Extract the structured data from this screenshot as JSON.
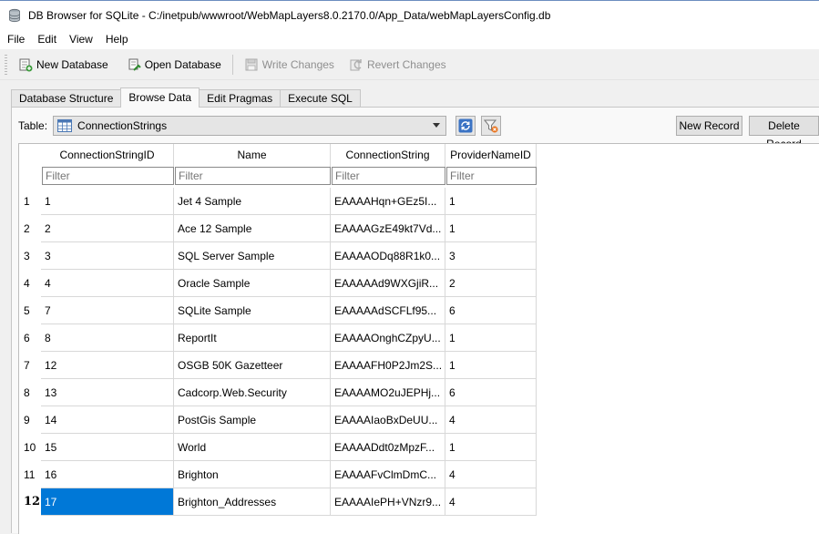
{
  "window": {
    "title": "DB Browser for SQLite - C:/inetpub/wwwroot/WebMapLayers8.0.2170.0/App_Data/webMapLayersConfig.db"
  },
  "menu": [
    "File",
    "Edit",
    "View",
    "Help"
  ],
  "toolbar": {
    "new_database": "New Database",
    "open_database": "Open Database",
    "write_changes": "Write Changes",
    "revert_changes": "Revert Changes"
  },
  "tabs": [
    "Database Structure",
    "Browse Data",
    "Edit Pragmas",
    "Execute SQL"
  ],
  "browse": {
    "table_label": "Table:",
    "table_value": "ConnectionStrings",
    "new_record": "New Record",
    "delete_record": "Delete Record"
  },
  "grid": {
    "columns": [
      "ConnectionStringID",
      "Name",
      "ConnectionString",
      "ProviderNameID"
    ],
    "filter_placeholder": "Filter",
    "rows": [
      [
        "1",
        "1",
        "Jet 4 Sample",
        "EAAAAHqn+GEz5I...",
        "1"
      ],
      [
        "2",
        "2",
        "Ace 12 Sample",
        "EAAAAGzE49kt7Vd...",
        "1"
      ],
      [
        "3",
        "3",
        "SQL Server Sample",
        "EAAAAODq88R1k0...",
        "3"
      ],
      [
        "4",
        "4",
        "Oracle Sample",
        "EAAAAAd9WXGjiR...",
        "2"
      ],
      [
        "5",
        "7",
        "SQLite Sample",
        "EAAAAAdSCFLf95...",
        "6"
      ],
      [
        "6",
        "8",
        "ReportIt",
        "EAAAAOnghCZpyU...",
        "1"
      ],
      [
        "7",
        "12",
        "OSGB 50K Gazetteer",
        "EAAAAFH0P2Jm2S...",
        "1"
      ],
      [
        "8",
        "13",
        "Cadcorp.Web.Security",
        "EAAAAMO2uJEPHj...",
        "6"
      ],
      [
        "9",
        "14",
        "PostGis Sample",
        "EAAAAIaoBxDeUU...",
        "4"
      ],
      [
        "10",
        "15",
        "World",
        "EAAAADdt0zMpzF...",
        "1"
      ],
      [
        "11",
        "16",
        "Brighton",
        "EAAAAFvClmDmC...",
        "4"
      ],
      [
        "12",
        "17",
        "Brighton_Addresses",
        "EAAAAIePH+VNzr9...",
        "4"
      ]
    ]
  },
  "colors": {
    "selection": "#0078d7",
    "panel": "#f9f9f9"
  }
}
